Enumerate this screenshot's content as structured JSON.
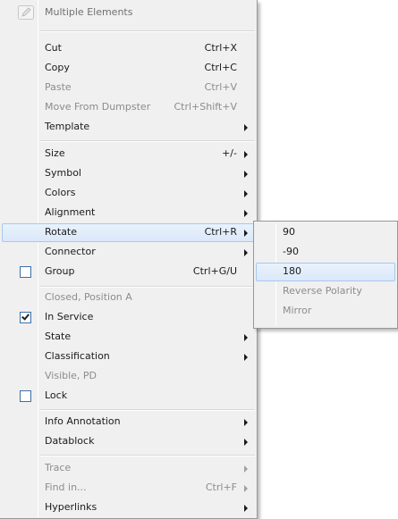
{
  "menu": {
    "header": "Multiple Elements",
    "items": {
      "cut": {
        "label": "Cut",
        "shortcut": "Ctrl+X"
      },
      "copy": {
        "label": "Copy",
        "shortcut": "Ctrl+C"
      },
      "paste": {
        "label": "Paste",
        "shortcut": "Ctrl+V"
      },
      "move_from_dumpster": {
        "label": "Move From Dumpster",
        "shortcut": "Ctrl+Shift+V"
      },
      "template": {
        "label": "Template"
      },
      "size": {
        "label": "Size",
        "shortcut": "+/-"
      },
      "symbol": {
        "label": "Symbol"
      },
      "colors": {
        "label": "Colors"
      },
      "alignment": {
        "label": "Alignment"
      },
      "rotate": {
        "label": "Rotate",
        "shortcut": "Ctrl+R"
      },
      "connector": {
        "label": "Connector"
      },
      "group": {
        "label": "Group",
        "shortcut": "Ctrl+G/U",
        "checked": false
      },
      "closed_position": {
        "label": "Closed, Position A"
      },
      "in_service": {
        "label": "In Service",
        "checked": true
      },
      "state": {
        "label": "State"
      },
      "classification": {
        "label": "Classification"
      },
      "visible_pd": {
        "label": "Visible, PD"
      },
      "lock": {
        "label": "Lock",
        "checked": false
      },
      "info_annotation": {
        "label": "Info Annotation"
      },
      "datablock": {
        "label": "Datablock"
      },
      "trace": {
        "label": "Trace"
      },
      "find_in": {
        "label": "Find in...",
        "shortcut": "Ctrl+F"
      },
      "hyperlinks": {
        "label": "Hyperlinks"
      }
    }
  },
  "rotate_submenu": {
    "items": {
      "r90": {
        "label": "90"
      },
      "rneg90": {
        "label": "-90"
      },
      "r180": {
        "label": "180"
      },
      "reverse_polarity": {
        "label": "Reverse Polarity"
      },
      "mirror": {
        "label": "Mirror"
      }
    }
  },
  "colors": {
    "highlight_border": "#a8c8ef",
    "highlight_fill": "#dbe8f9",
    "disabled_text": "#8c8c8c",
    "checkbox_border": "#3d6fa8"
  }
}
